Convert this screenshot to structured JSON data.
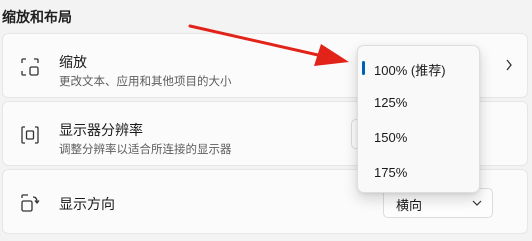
{
  "section_title": "缩放和布局",
  "colors": {
    "accent": "#005fb8",
    "annotation_arrow": "#e2231a"
  },
  "cards": [
    {
      "icon": "scale-icon",
      "title": "缩放",
      "description": "更改文本、应用和其他项目的大小",
      "control": "chevron-right-icon"
    },
    {
      "icon": "display-resolution-icon",
      "title": "显示器分辨率",
      "description": "调整分辨率以适合所连接的显示器",
      "control": "dropdown"
    },
    {
      "icon": "display-orientation-icon",
      "title": "显示方向",
      "control": "dropdown",
      "selected_value": "横向"
    }
  ],
  "scale_dropdown": {
    "options": [
      "100% (推荐)",
      "125%",
      "150%",
      "175%"
    ],
    "selected_index": 0
  }
}
